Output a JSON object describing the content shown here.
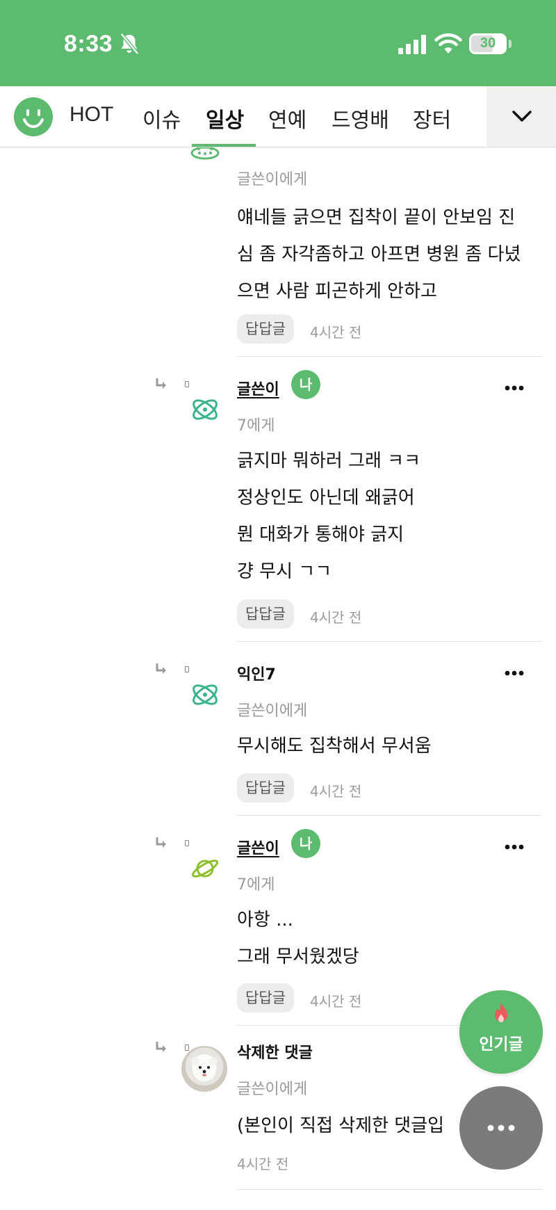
{
  "status_bar": {
    "time": "8:33",
    "battery": "30",
    "icons": [
      "bell-slash-icon",
      "cellular-signal-icon",
      "wifi-icon",
      "battery-icon"
    ]
  },
  "nav": {
    "logo": "smiley-logo-icon",
    "tabs": [
      {
        "label": "HOT",
        "active": false
      },
      {
        "label": "이슈",
        "active": false
      },
      {
        "label": "일상",
        "active": true
      },
      {
        "label": "연예",
        "active": false
      },
      {
        "label": "드영배",
        "active": false
      },
      {
        "label": "장터",
        "active": false
      }
    ],
    "expand_icon": "chevron-down-icon"
  },
  "comments": [
    {
      "id": "c0",
      "avatar_icon": "ufo-icon",
      "target": "글쓴이에게",
      "lines": [
        "얘네들 긁으면 집착이 끝이 안보임 진",
        "심 좀 자각좀하고 아프면 병원 좀 다녔",
        "으면 사람 피곤하게 안하고"
      ],
      "reply_label": "답답글",
      "time": "4시간 전"
    },
    {
      "id": "c1",
      "avatar_icon": "atom-icon",
      "author": "글쓴이",
      "me_badge": "나",
      "target": "7에게",
      "lines": [
        "긁지마 뭐하러 그래 ㅋㅋ",
        "정상인도 아닌데 왜긁어",
        "뭔 대화가 통해야 긁지",
        "걍 무시 ㄱㄱ"
      ],
      "reply_label": "답답글",
      "time": "4시간 전"
    },
    {
      "id": "c2",
      "avatar_icon": "atom-icon",
      "author": "익인7",
      "target": "글쓴이에게",
      "lines": [
        "무시해도 집착해서 무서움"
      ],
      "reply_label": "답답글",
      "time": "4시간 전"
    },
    {
      "id": "c3",
      "avatar_icon": "planet-icon",
      "author": "글쓴이",
      "me_badge": "나",
      "target": "7에게",
      "lines": [
        "아항 ...",
        "그래 무서웠겠당"
      ],
      "reply_label": "답답글",
      "time": "4시간 전"
    },
    {
      "id": "c4",
      "avatar_icon": "dog-photo-avatar",
      "author": "삭제한 댓글",
      "target": "글쓴이에게",
      "lines": [
        "(본인이 직접 삭제한 댓글입"
      ],
      "time": "4시간 전"
    }
  ],
  "fab": {
    "popular_label": "인기글",
    "popular_icon": "flame-icon",
    "menu_icon": "more-horizontal-icon"
  },
  "colors": {
    "brand_green": "#5cbb6e",
    "muted_text": "#9a9a9a",
    "pill_bg": "#ececec",
    "menu_fab": "#7b7b7b"
  }
}
